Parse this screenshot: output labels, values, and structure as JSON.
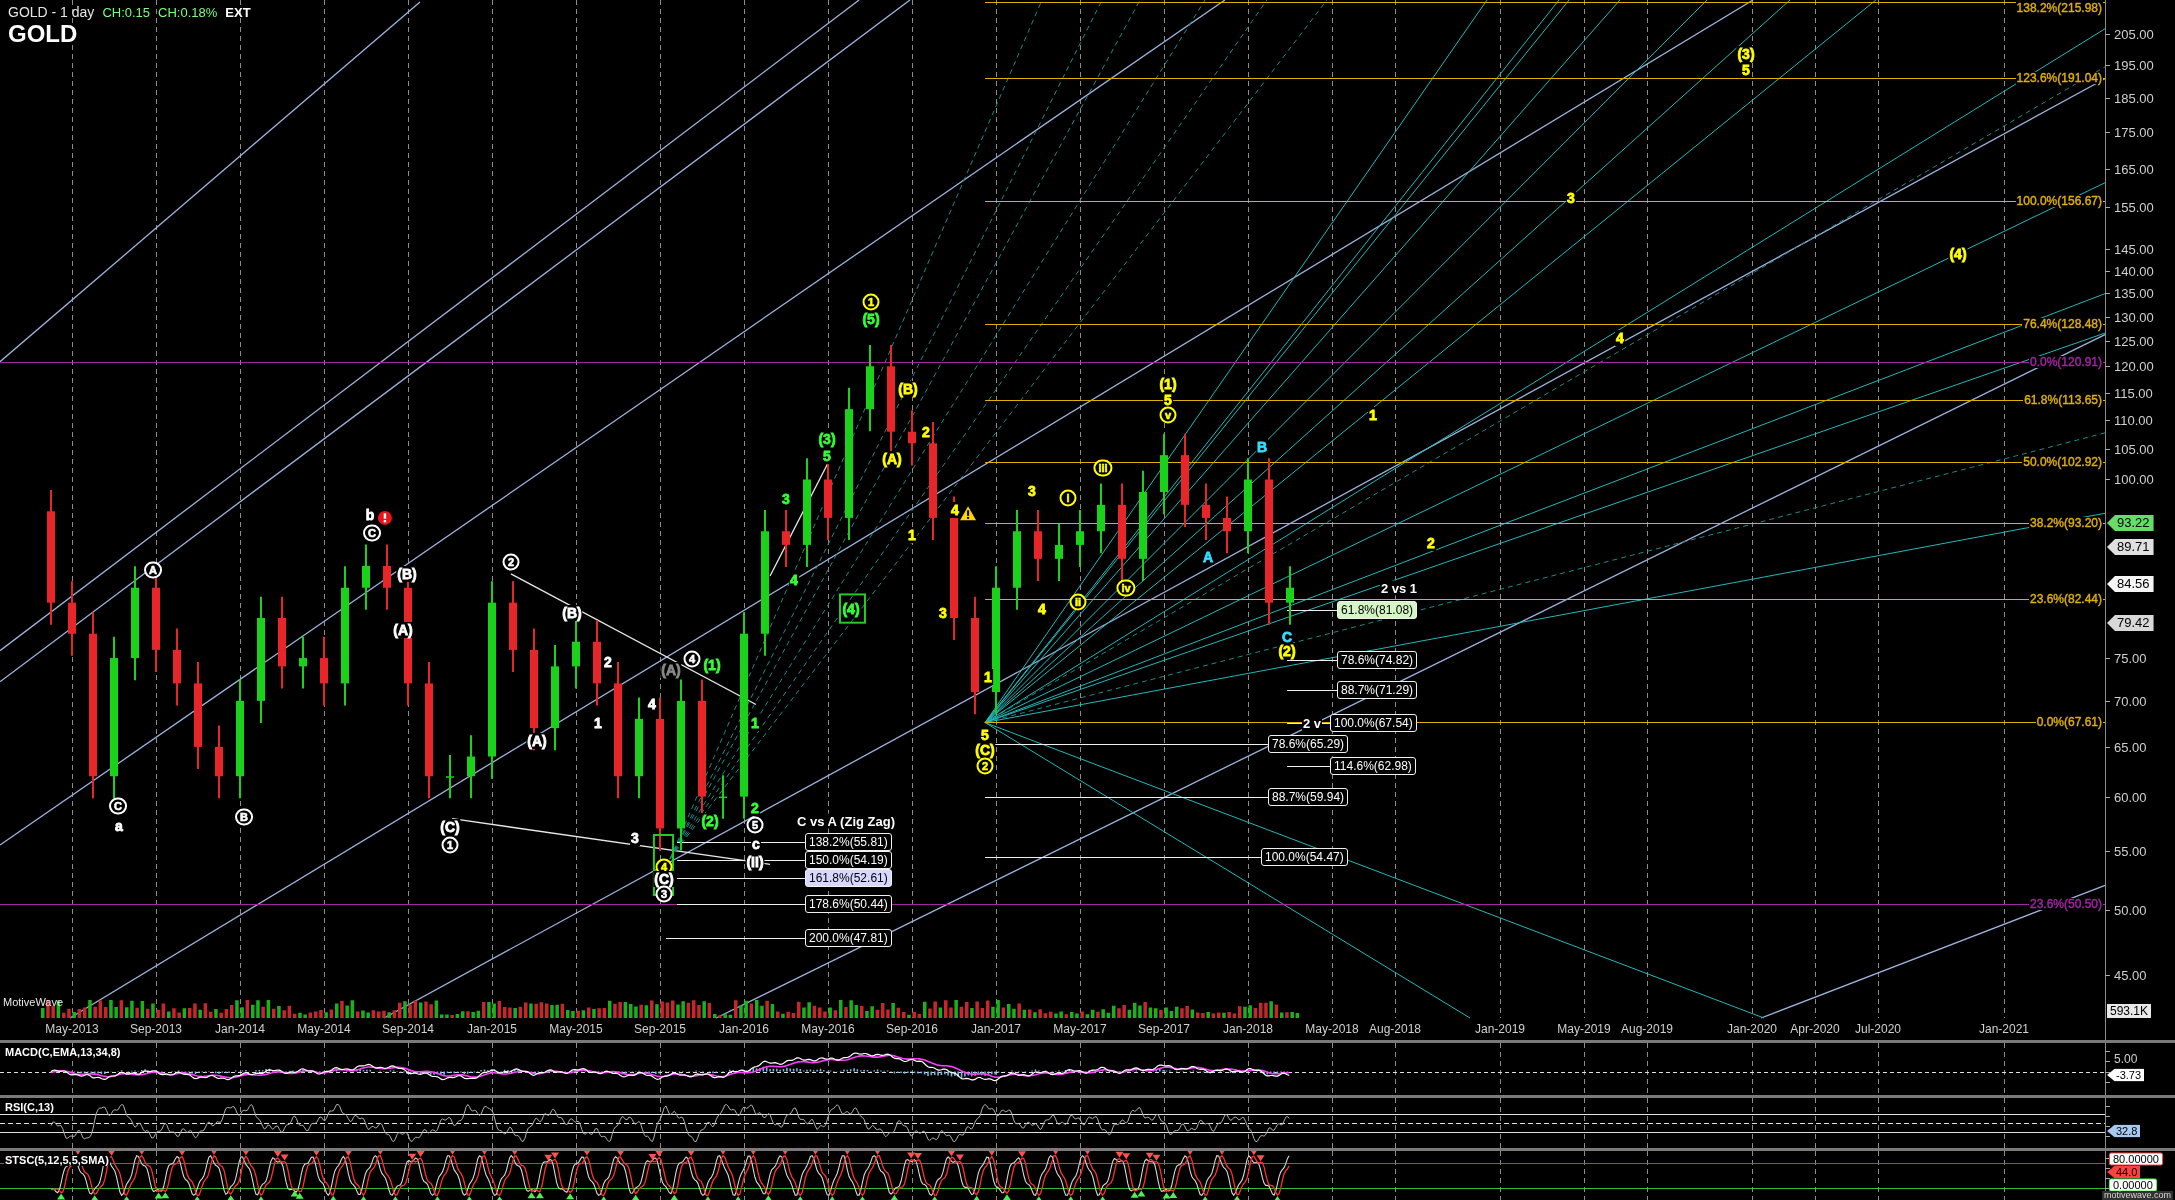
{
  "header": {
    "title": "GOLD - 1 day",
    "changes": [
      "CH:0.15",
      "CH:0.18%"
    ],
    "session": "EXT",
    "symbol": "GOLD"
  },
  "price_chart": {
    "brand": "MotiveWave",
    "volume_tag": "593.1K",
    "date_axis_labels": [
      "May-2013",
      "Sep-2013",
      "Jan-2014",
      "May-2014",
      "Sep-2014",
      "Jan-2015",
      "May-2015",
      "Sep-2015",
      "Jan-2016",
      "May-2016",
      "Sep-2016",
      "Jan-2017",
      "May-2017",
      "Sep-2017",
      "Jan-2018",
      "May-2018",
      "Aug-2018",
      "Jan-2019",
      "May-2019",
      "Aug-2019",
      "Jan-2020",
      "Apr-2020",
      "Jul-2020",
      "Jan-2021"
    ],
    "price_axis_labels": [
      "205.00",
      "195.00",
      "185.00",
      "175.00",
      "165.00",
      "155.00",
      "145.00",
      "140.00",
      "135.00",
      "130.00",
      "125.00",
      "120.00",
      "115.00",
      "110.00",
      "105.00",
      "100.00",
      "75.00",
      "70.00",
      "65.00",
      "60.00",
      "55.00",
      "50.00",
      "45.00"
    ],
    "fib_levels": [
      {
        "text": "138.2%(215.98)",
        "color": "#e0b000"
      },
      {
        "text": "123.6%(191.04)",
        "color": "#e0b000"
      },
      {
        "text": "100.0%(156.67)",
        "color": "#e0b000"
      },
      {
        "text": "76.4%(128.48)",
        "color": "#e0b000"
      },
      {
        "text": "0.0%(120.91)",
        "color": "#a424a4"
      },
      {
        "text": "61.8%(113.65)",
        "color": "#e0b000"
      },
      {
        "text": "50.0%(102.92)",
        "color": "#e0b000"
      },
      {
        "text": "38.2%(93.20)",
        "color": "#e0b000"
      },
      {
        "text": "23.6%(82.44)",
        "color": "#e0b000"
      },
      {
        "text": "0.0%(67.61)",
        "color": "#e0b000"
      },
      {
        "text": "23.6%(50.50)",
        "color": "#a424a4"
      }
    ],
    "fib_extensions": [
      {
        "text": "61.8%(81.08)",
        "color": "#d4f5c4"
      },
      {
        "text": "78.6%(74.82)",
        "color": "#000000"
      },
      {
        "text": "88.7%(71.29)",
        "color": "#000000"
      },
      {
        "text": "100.0%(67.54)",
        "color": "#000000"
      },
      {
        "text": "78.6%(65.29)",
        "color": "#000000"
      },
      {
        "text": "114.6%(62.98)",
        "color": "#000000"
      },
      {
        "text": "88.7%(59.94)",
        "color": "#000000"
      },
      {
        "text": "100.0%(54.47)",
        "color": "#000000"
      },
      {
        "text": "138.2%(55.81)",
        "color": "#000000"
      },
      {
        "text": "150.0%(54.19)",
        "color": "#000000"
      },
      {
        "text": "161.8%(52.61)",
        "color": "#d8d8ff"
      },
      {
        "text": "178.6%(50.44)",
        "color": "#000000"
      },
      {
        "text": "200.0%(47.81)",
        "color": "#000000"
      }
    ],
    "wave_labels": [
      {
        "text": "(3)",
        "color": "#ffff00",
        "circled": false
      },
      {
        "text": "5",
        "color": "#ffff00",
        "circled": false
      },
      {
        "text": "3",
        "color": "#ffff00",
        "circled": false
      },
      {
        "text": "(4)",
        "color": "#ffff00",
        "circled": false
      },
      {
        "text": "1",
        "color": "#ffff00",
        "circled": true
      },
      {
        "text": "(5)",
        "color": "#33ff33",
        "circled": false
      },
      {
        "text": "4",
        "color": "#ffff00",
        "circled": false
      },
      {
        "text": "(B)",
        "color": "#ffff00",
        "circled": false
      },
      {
        "text": "(1)",
        "color": "#ffff00",
        "circled": false
      },
      {
        "text": "5",
        "color": "#ffff00",
        "circled": false
      },
      {
        "text": "v",
        "color": "#ffff00",
        "circled": true
      },
      {
        "text": "1",
        "color": "#ffff00",
        "circled": false
      },
      {
        "text": "(3)",
        "color": "#33ff33",
        "circled": false
      },
      {
        "text": "2",
        "color": "#ffff00",
        "circled": false
      },
      {
        "text": "B",
        "color": "#33ddff",
        "circled": false
      },
      {
        "text": "5",
        "color": "#33ff33",
        "circled": false
      },
      {
        "text": "(A)",
        "color": "#ffff00",
        "circled": false
      },
      {
        "text": "iii",
        "color": "#ffff00",
        "circled": true
      },
      {
        "text": "3",
        "color": "#33ff33",
        "circled": false
      },
      {
        "text": "3",
        "color": "#ffff00",
        "circled": false
      },
      {
        "text": "i",
        "color": "#ffff00",
        "circled": true
      },
      {
        "text": "b",
        "color": "#ffffff",
        "circled": false
      },
      {
        "text": "4",
        "color": "#ffff00",
        "circled": false
      },
      {
        "text": "C",
        "color": "#ffffff",
        "circled": true
      },
      {
        "text": "1",
        "color": "#ffff00",
        "circled": false
      },
      {
        "text": "2",
        "color": "#ffff00",
        "circled": false
      },
      {
        "text": "A",
        "color": "#ffffff",
        "circled": true
      },
      {
        "text": "(B)",
        "color": "#ffffff",
        "circled": false
      },
      {
        "text": "2",
        "color": "#ffffff",
        "circled": true
      },
      {
        "text": "4",
        "color": "#33ff33",
        "circled": false
      },
      {
        "text": "A",
        "color": "#33ddff",
        "circled": false
      },
      {
        "text": "iv",
        "color": "#ffff00",
        "circled": true
      },
      {
        "text": "(B)",
        "color": "#ffffff",
        "circled": false
      },
      {
        "text": "(4)",
        "color": "#33ff33",
        "circled": false
      },
      {
        "text": "3",
        "color": "#ffff00",
        "circled": false
      },
      {
        "text": "4",
        "color": "#ffff00",
        "circled": false
      },
      {
        "text": "ii",
        "color": "#ffff00",
        "circled": true
      },
      {
        "text": "(A)",
        "color": "#ffffff",
        "circled": false
      },
      {
        "text": "C",
        "color": "#33ddff",
        "circled": false
      },
      {
        "text": "2",
        "color": "#ffffff",
        "circled": false
      },
      {
        "text": "(A)",
        "color": "#8a8a8a",
        "circled": false
      },
      {
        "text": "4",
        "color": "#ffffff",
        "circled": true
      },
      {
        "text": "(1)",
        "color": "#33ff33",
        "circled": false
      },
      {
        "text": "(2)",
        "color": "#ffff00",
        "circled": false
      },
      {
        "text": "1",
        "color": "#ffff00",
        "circled": false
      },
      {
        "text": "4",
        "color": "#ffffff",
        "circled": false
      },
      {
        "text": "1",
        "color": "#ffffff",
        "circled": false
      },
      {
        "text": "1",
        "color": "#33ff33",
        "circled": false
      },
      {
        "text": "(A)",
        "color": "#ffffff",
        "circled": false
      },
      {
        "text": "5",
        "color": "#ffff00",
        "circled": false
      },
      {
        "text": "(C)",
        "color": "#ffff00",
        "circled": false
      },
      {
        "text": "2",
        "color": "#ffff00",
        "circled": true
      },
      {
        "text": "C",
        "color": "#ffffff",
        "circled": true
      },
      {
        "text": "a",
        "color": "#ffffff",
        "circled": false
      },
      {
        "text": "B",
        "color": "#ffffff",
        "circled": true
      },
      {
        "text": "(C)",
        "color": "#ffffff",
        "circled": false
      },
      {
        "text": "(2)",
        "color": "#33ff33",
        "circled": false
      },
      {
        "text": "2",
        "color": "#33ff33",
        "circled": false
      },
      {
        "text": "5",
        "color": "#ffffff",
        "circled": true
      },
      {
        "text": "1",
        "color": "#ffffff",
        "circled": true
      },
      {
        "text": "3",
        "color": "#ffffff",
        "circled": false
      },
      {
        "text": "c",
        "color": "#ffffff",
        "circled": false
      },
      {
        "text": "4",
        "color": "#ffff00",
        "circled": true
      },
      {
        "text": "(II)",
        "color": "#ffffff",
        "circled": false
      },
      {
        "text": "(C)",
        "color": "#ffffff",
        "circled": false
      },
      {
        "text": "3",
        "color": "#ffffff",
        "circled": true
      }
    ],
    "notes": [
      "2 vs 1",
      "2 v",
      "C vs A (Zig Zag)"
    ],
    "price_tags": [
      {
        "text": "93.22",
        "color": "#66dd66"
      },
      {
        "text": "89.71",
        "color": "#e0e0e0"
      },
      {
        "text": "84.56",
        "color": "#f5f5f5"
      },
      {
        "text": "79.42",
        "color": "#d8d8d8"
      }
    ]
  },
  "indicators": [
    {
      "kind": "macd",
      "label": "MACD(C,EMA,13,34,8)",
      "axis_labels": [
        "5.00"
      ],
      "tags": [
        {
          "text": "-3.73",
          "color": "#ffffff",
          "kind": "filled"
        }
      ]
    },
    {
      "kind": "rsi",
      "label": "RSI(C,13)",
      "tags": [
        {
          "text": "32.8",
          "color": "#a8c8f0",
          "kind": "filled"
        }
      ]
    },
    {
      "kind": "stsc",
      "label": "STSC(5,12,5,5,SMA)",
      "tags": [
        {
          "text": "80.00000",
          "color": "#ff4040",
          "kind": "outlined"
        },
        {
          "text": "44.0",
          "color": "#ff4040",
          "kind": "filled"
        },
        {
          "text": "0.00000",
          "color": "#40ff40",
          "kind": "outlined"
        }
      ]
    }
  ],
  "footer_url": "motivewave.com"
}
